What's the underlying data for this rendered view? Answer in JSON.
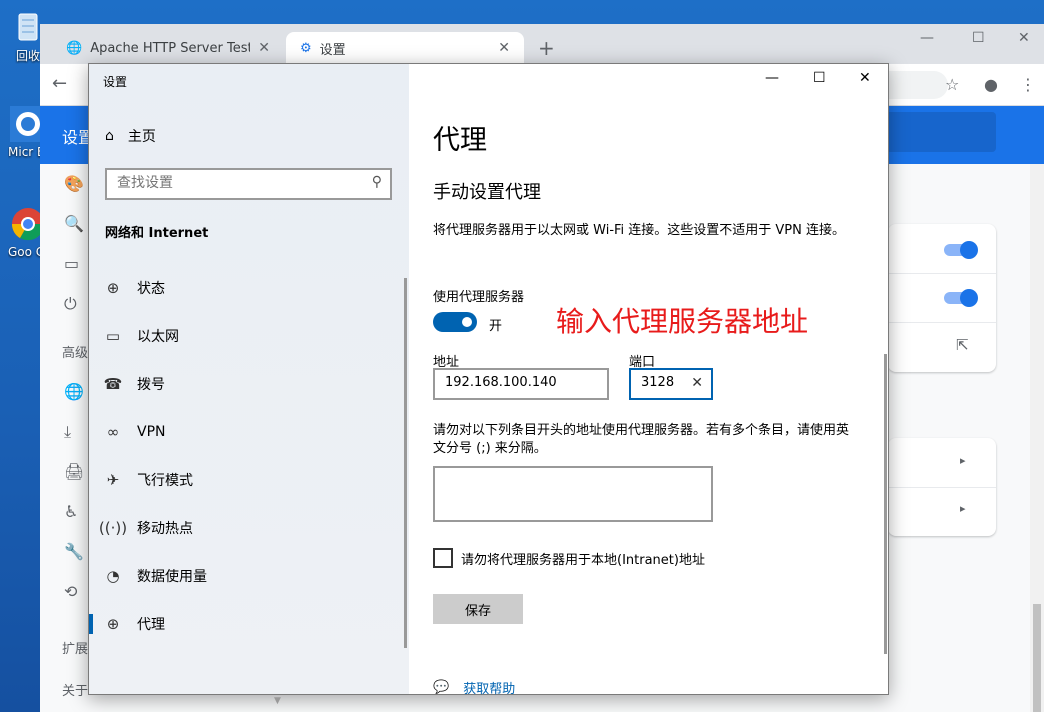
{
  "desktop": {
    "icons": [
      {
        "label": "回收",
        "icon": "recycle-bin-icon"
      },
      {
        "label": "Micr Ed",
        "icon": "edge-icon"
      },
      {
        "label": "Goo Chr",
        "icon": "chrome-icon"
      }
    ]
  },
  "browser": {
    "tabs": [
      {
        "label": "Apache HTTP Server Test Page",
        "icon": "globe-icon"
      },
      {
        "label": "设置",
        "icon": "gear-icon"
      }
    ],
    "settings_title": "设置",
    "left_nav_text": [
      "高级",
      "扩展",
      "关于"
    ]
  },
  "dialog": {
    "title": "设置",
    "home_label": "主页",
    "search_placeholder": "查找设置",
    "section_header": "网络和 Internet",
    "nav_items": [
      {
        "label": "状态",
        "icon": "globe-icon"
      },
      {
        "label": "以太网",
        "icon": "monitor-icon"
      },
      {
        "label": "拨号",
        "icon": "dialup-icon"
      },
      {
        "label": "VPN",
        "icon": "vpn-icon"
      },
      {
        "label": "飞行模式",
        "icon": "airplane-icon"
      },
      {
        "label": "移动热点",
        "icon": "hotspot-icon"
      },
      {
        "label": "数据使用量",
        "icon": "data-usage-icon"
      },
      {
        "label": "代理",
        "icon": "globe-icon"
      }
    ],
    "active_nav": "代理",
    "page_title": "代理",
    "section_title": "手动设置代理",
    "description": "将代理服务器用于以太网或 Wi-Fi 连接。这些设置不适用于 VPN 连接。",
    "use_proxy_label": "使用代理服务器",
    "toggle_state": "开",
    "annotation": "输入代理服务器地址",
    "address_label": "地址",
    "address_value": "192.168.100.140",
    "port_label": "端口",
    "port_value": "3128",
    "exceptions_text": "请勿对以下列条目开头的地址使用代理服务器。若有多个条目，请使用英文分号 (;) 来分隔。",
    "exceptions_value": "",
    "bypass_local_label": "请勿将代理服务器用于本地(Intranet)地址",
    "save_label": "保存",
    "help_label": "获取帮助"
  },
  "colors": {
    "accent": "#0063b1",
    "annotation": "#e81b1b",
    "chrome_blue": "#1a73e8"
  }
}
